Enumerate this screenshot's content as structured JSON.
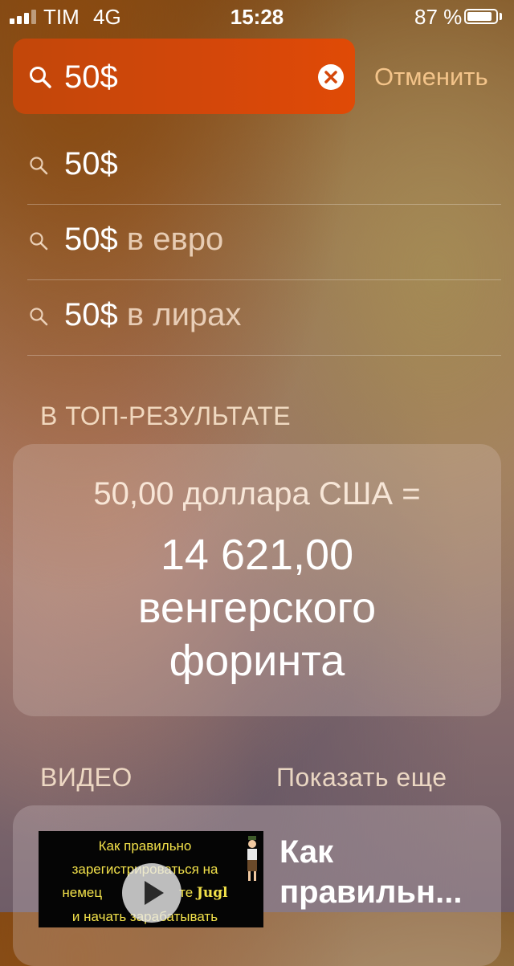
{
  "status_bar": {
    "carrier": "TIM",
    "network": "4G",
    "time": "15:28",
    "battery_percent": "87 %",
    "battery_level": 0.87,
    "signal_bars_filled": 3,
    "signal_bars_total": 4
  },
  "search": {
    "value": "50$",
    "cancel_label": "Отменить",
    "icon": "search-icon",
    "clear_icon": "clear-icon"
  },
  "suggestions": [
    {
      "main": "50$",
      "rest": ""
    },
    {
      "main": "50$",
      "rest": " в евро"
    },
    {
      "main": "50$",
      "rest": " в лирах"
    }
  ],
  "top_result": {
    "section_title": "В ТОП-РЕЗУЛЬТАТЕ",
    "from": "50,00 доллара США =",
    "to_line1": "14 621,00",
    "to_line2": "венгерского",
    "to_line3": "форинта"
  },
  "video": {
    "section_title": "ВИДЕО",
    "show_more_label": "Показать еще",
    "thumbnail_line1": "Как правильно",
    "thumbnail_line2": "зарегистрироваться на",
    "thumbnail_line3a": "немец",
    "thumbnail_line3b": "те",
    "thumbnail_brand": "Jugl",
    "thumbnail_line4": "и начать зарабатывать",
    "title_line1": "Как",
    "title_line2": "правильн..."
  },
  "colors": {
    "accent_orange": "#d4470a",
    "cancel_text": "#f4c48a"
  }
}
